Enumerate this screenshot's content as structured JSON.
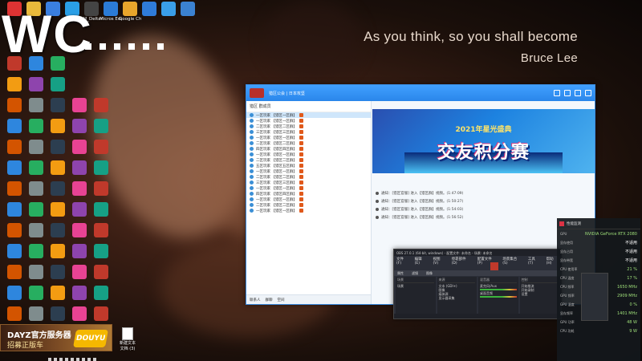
{
  "wallpaper": {
    "quote": "As you think, so you shall become",
    "author": "Bruce Lee"
  },
  "overlay": {
    "wc_text": "WC"
  },
  "desktop": {
    "top_icons": [
      {
        "label": "",
        "color": "#d33"
      },
      {
        "label": "",
        "color": "#e9b93b"
      },
      {
        "label": "",
        "color": "#3a7fe0"
      },
      {
        "label": "",
        "color": "#2a9fe6"
      },
      {
        "label": "SM_Deltar...",
        "color": "#444"
      },
      {
        "label": "Micros Edge",
        "color": "#2b7bd6"
      },
      {
        "label": "Google Chrome",
        "color": "#e8a52c"
      },
      {
        "label": "",
        "color": "#2f7bd9"
      },
      {
        "label": "",
        "color": "#3a9ee8"
      },
      {
        "label": "",
        "color": "#3b82d1"
      }
    ],
    "files": [
      {
        "label": "新建文本文档 (3)"
      }
    ]
  },
  "qq": {
    "header": {
      "group_name": "猎区公会 | 日本攻坚",
      "left_title": "猎区 群成员"
    },
    "banner": {
      "subtitle": "2021年星光盛典",
      "title": "交友积分赛"
    },
    "messages": [
      {
        "text": "通知：[猎区官服] 进入【猎区群】视频。(1:47:09)",
        "highlight": "[猎区官服]"
      },
      {
        "text": "通知：[猎区官服] 进入【猎区群】视频。(1:50:27)",
        "highlight": "[猎区官服]"
      },
      {
        "text": "通知：[猎区官服] 进入【猎区群】视频。(1:54:03)",
        "highlight": "[猎区官服]"
      },
      {
        "text": "通知：[猎区官服] 进入【猎区群】视频。(1:56:52)",
        "highlight": "[猎区官服]"
      }
    ],
    "left_rows": [
      "一区玩家 【猎区一区群】",
      "一区玩家 【猎区一区群】",
      "二区玩家 【猎区二区群】",
      "三区玩家 【猎区三区群】",
      "一区玩家 【猎区一区群】",
      "二区玩家 【猎区二区群】",
      "四区玩家 【猎区四区群】",
      "一区玩家 【猎区一区群】",
      "二区玩家 【猎区二区群】",
      "五区玩家 【猎区五区群】",
      "一区玩家 【猎区一区群】",
      "二区玩家 【猎区二区群】",
      "三区玩家 【猎区三区群】",
      "一区玩家 【猎区一区群】",
      "四区玩家 【猎区四区群】",
      "一区玩家 【猎区一区群】",
      "二区玩家 【猎区二区群】",
      "一区玩家 【猎区一区群】"
    ],
    "footer_tabs": [
      "联系人",
      "群聊",
      "空间"
    ]
  },
  "obs": {
    "title": "OBS 27.0.1 (64-bit, windows) - 配置文件: 未命名 - 场景: 未命名",
    "menu": [
      "文件(F)",
      "编辑(E)",
      "视图(V)",
      "停靠部件(D)",
      "配置文件(P)",
      "场景集合(S)",
      "工具(T)",
      "帮助(H)"
    ],
    "bar": [
      "属性",
      "滤镜",
      "图像"
    ],
    "docks": [
      {
        "title": "场景",
        "items": [
          "场景"
        ]
      },
      {
        "title": "来源",
        "items": [
          "文本 (GDI+)",
          "图像",
          "媒体源",
          "显示器采集"
        ]
      },
      {
        "title": "混音器",
        "items": [
          "麦克风/Aux",
          "桌面音频"
        ]
      },
      {
        "title": "控制",
        "items": [
          "开始推流",
          "开始录制",
          "设置"
        ]
      }
    ]
  },
  "monitor": {
    "title": "性能监测",
    "rows": [
      {
        "label": "GPU",
        "value": "NVIDIA GeForce RTX 2080"
      },
      {
        "label": "显存使用",
        "value": "不适用"
      },
      {
        "label": "显存占用",
        "value": "不适用"
      },
      {
        "label": "显存带宽",
        "value": "不适用"
      },
      {
        "label": "CPU 使用率",
        "value": "21 %"
      },
      {
        "label": "CPU 温度",
        "value": "17 %"
      },
      {
        "label": "CPU 频率",
        "value": "1650 MHz"
      },
      {
        "label": "GPU 频率",
        "value": "2909 MHz"
      },
      {
        "label": "GPU 温度",
        "value": "0 %"
      },
      {
        "label": "显存频率",
        "value": "1401 MHz"
      },
      {
        "label": "GPU 功率",
        "value": "48 W"
      },
      {
        "label": "CPU 功耗",
        "value": "9 W"
      }
    ]
  },
  "douyu": {
    "line1": "DAYZ官方服务器",
    "line2": "招募正版车",
    "logo": "DOUYU"
  }
}
